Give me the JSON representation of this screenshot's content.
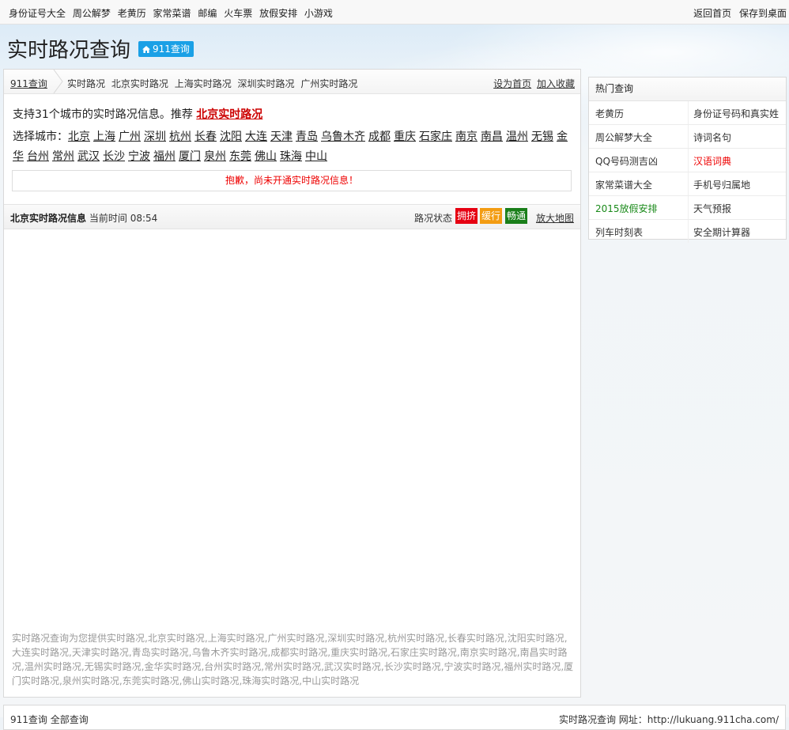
{
  "topbar": {
    "left_links": [
      "身份证号大全",
      "周公解梦",
      "老黄历",
      "家常菜谱",
      "邮编",
      "火车票",
      "放假安排",
      "小游戏"
    ],
    "right_links": [
      "返回首页",
      "保存到桌面"
    ]
  },
  "header": {
    "title": "实时路况查询",
    "badge": "911查询"
  },
  "breadcrumb": {
    "home": "911查询",
    "links": [
      "实时路况",
      "北京实时路况",
      "上海实时路况",
      "深圳实时路况",
      "广州实时路况"
    ],
    "set_home": "设为首页",
    "add_fav": "加入收藏"
  },
  "intro": {
    "text": "支持31个城市的实时路况信息。推荐",
    "recommend": "北京实时路况"
  },
  "city_select": {
    "label": "选择城市：",
    "cities": [
      "北京",
      "上海",
      "广州",
      "深圳",
      "杭州",
      "长春",
      "沈阳",
      "大连",
      "天津",
      "青岛",
      "乌鲁木齐",
      "成都",
      "重庆",
      "石家庄",
      "南京",
      "南昌",
      "温州",
      "无锡",
      "金华",
      "台州",
      "常州",
      "武汉",
      "长沙",
      "宁波",
      "福州",
      "厦门",
      "泉州",
      "东莞",
      "佛山",
      "珠海",
      "中山"
    ]
  },
  "notice": "抱歉，尚未开通实时路况信息！",
  "info_bar": {
    "title": "北京实时路况信息",
    "time_label": "当前时间",
    "time": "08:54",
    "status_label": "路况状态",
    "status": [
      {
        "label": "拥挤",
        "color": "#e60012"
      },
      {
        "label": "缓行",
        "color": "#f39c12"
      },
      {
        "label": "畅通",
        "color": "#1a7f1a"
      }
    ],
    "enlarge": "放大地图"
  },
  "footer_text": "实时路况查询为您提供实时路况,北京实时路况,上海实时路况,广州实时路况,深圳实时路况,杭州实时路况,长春实时路况,沈阳实时路况,大连实时路况,天津实时路况,青岛实时路况,乌鲁木齐实时路况,成都实时路况,重庆实时路况,石家庄实时路况,南京实时路况,南昌实时路况,温州实时路况,无锡实时路况,金华实时路况,台州实时路况,常州实时路况,武汉实时路况,长沙实时路况,宁波实时路况,福州实时路况,厦门实时路况,泉州实时路况,东莞实时路况,佛山实时路况,珠海实时路况,中山实时路况",
  "sidebar": {
    "heading": "热门查询",
    "rows": [
      {
        "a": "老黄历",
        "b": "身份证号码和真实姓"
      },
      {
        "a": "周公解梦大全",
        "b": "诗词名句"
      },
      {
        "a": "QQ号码测吉凶",
        "b": "汉语词典"
      },
      {
        "a": "家常菜谱大全",
        "b": "手机号归属地"
      },
      {
        "a": "2015放假安排",
        "b": "天气预报"
      },
      {
        "a": "列车时刻表",
        "b": "安全期计算器"
      }
    ]
  },
  "bottom": {
    "left": "911查询 全部查询",
    "right": "实时路况查询 网址：http://lukuang.911cha.com/"
  },
  "colors": {
    "accent": "#1aa0e6",
    "alert": "#e00000"
  }
}
